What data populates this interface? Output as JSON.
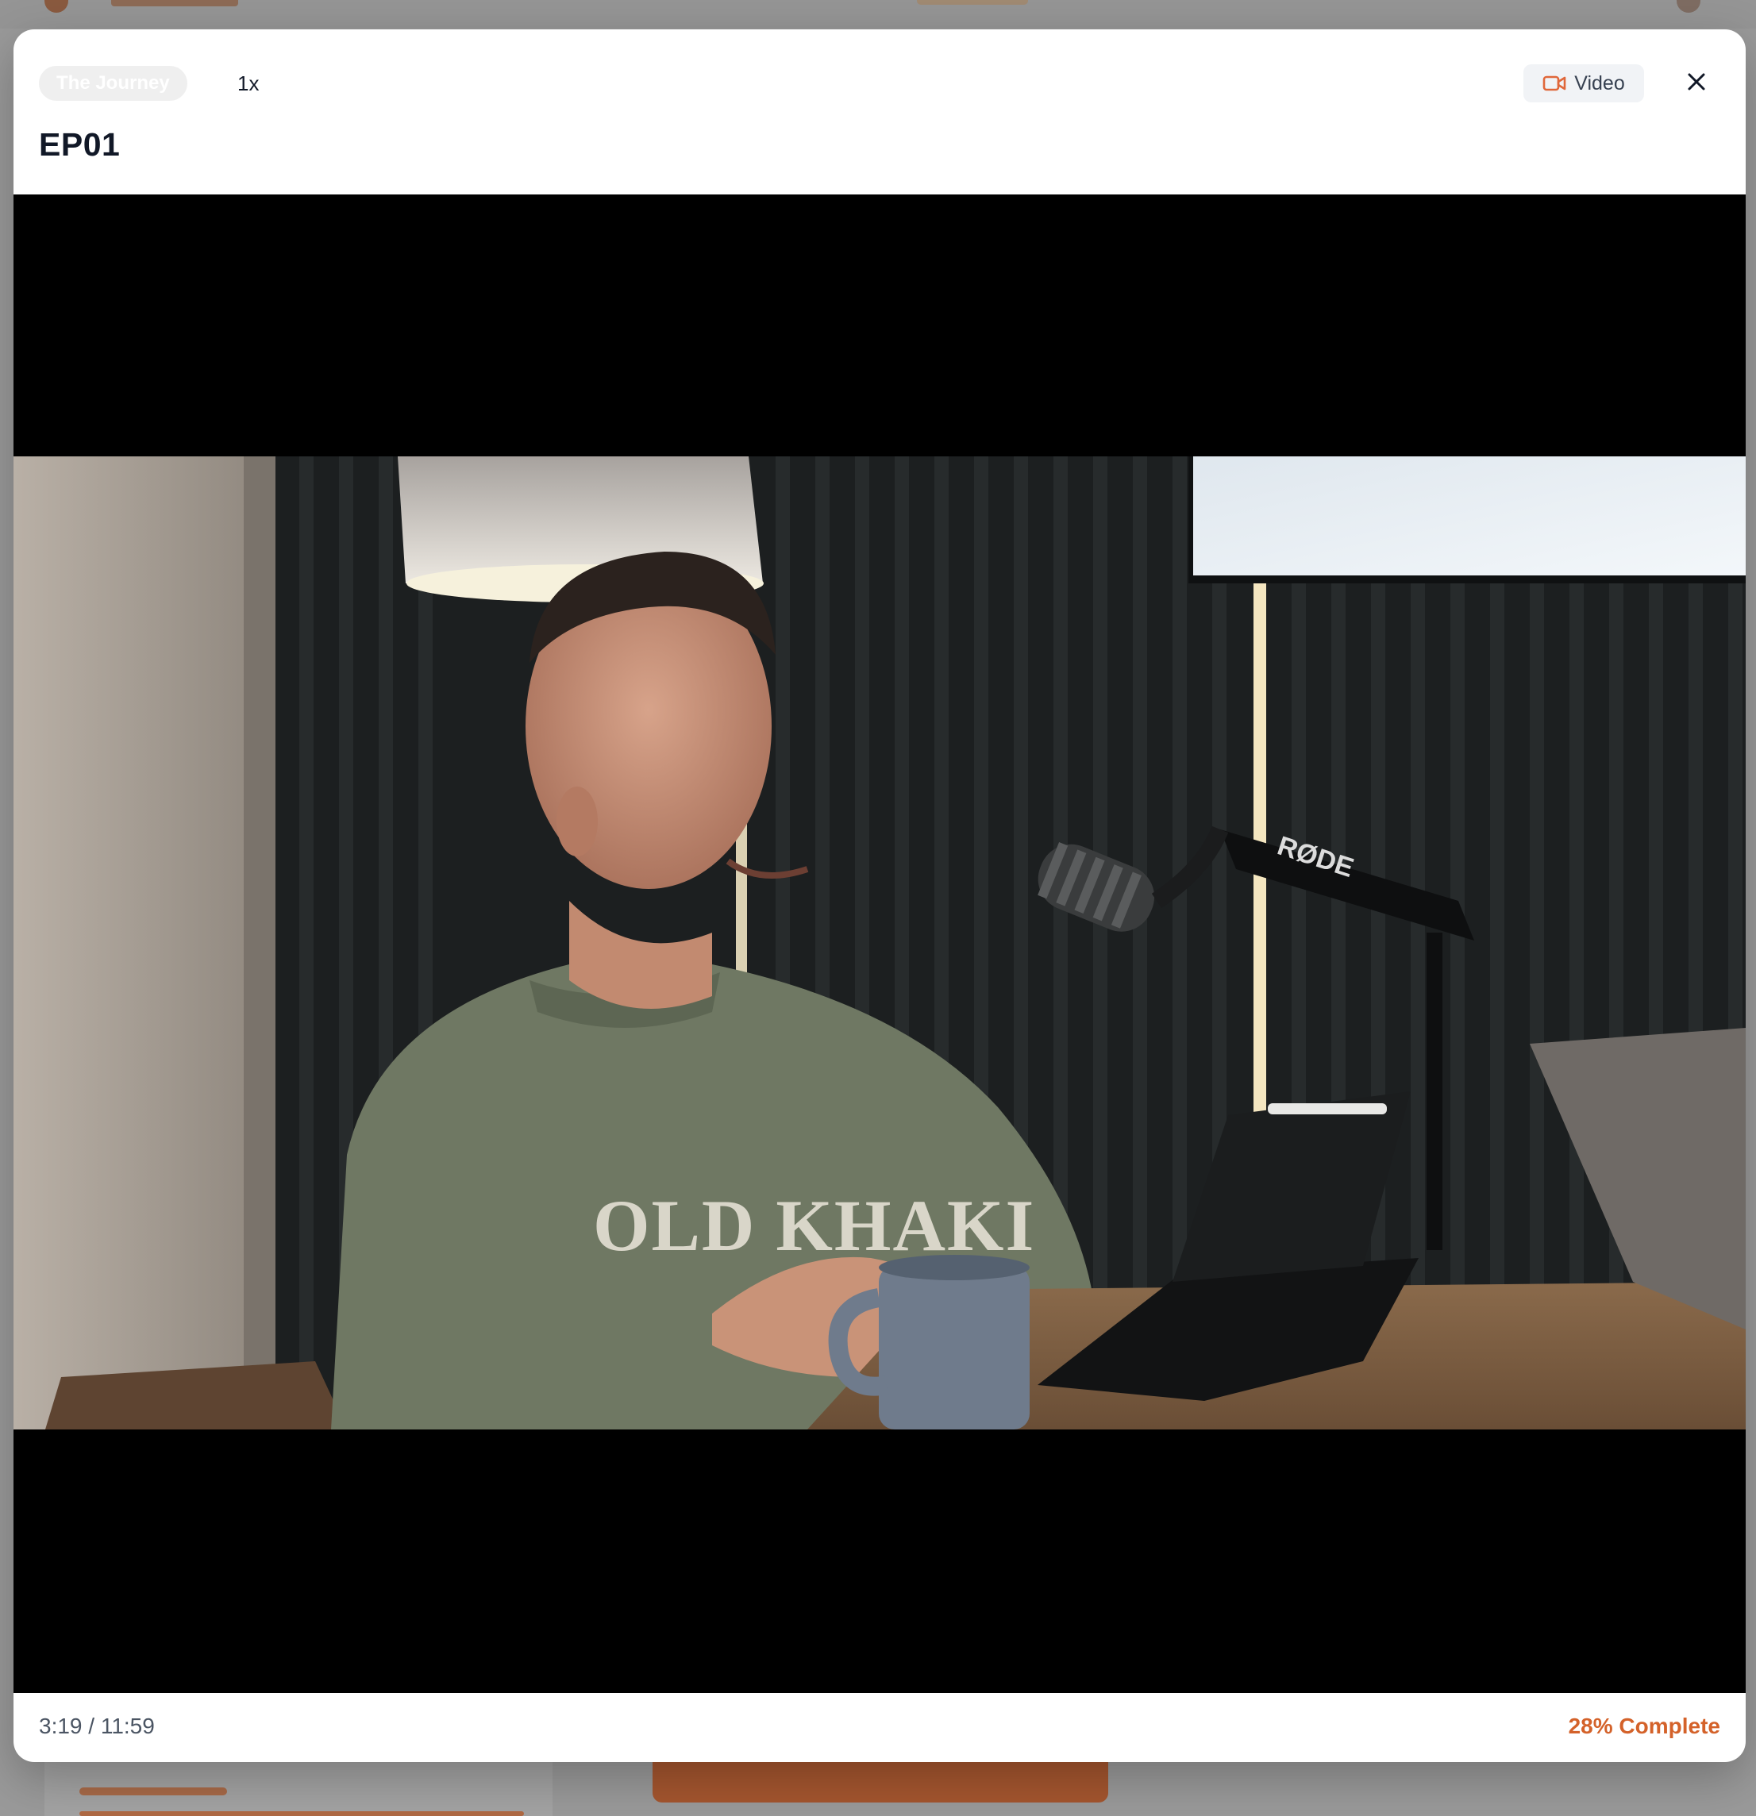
{
  "modal": {
    "series_label": "The Journey",
    "speed_label": "1x",
    "media_type_label": "Video",
    "episode_title": "EP01"
  },
  "player": {
    "current_time": "3:19",
    "duration": "11:59",
    "time_display": "3:19 / 11:59",
    "progress_text": "28% Complete",
    "progress_fraction": 0.28,
    "sweatshirt_text": "OLD KHAKI",
    "mic_brand": "RØDE"
  },
  "colors": {
    "accent": "#d4622a",
    "video_icon": "#e0673a",
    "title_text": "#111827",
    "muted_text": "#4b5563"
  },
  "icons": {
    "media_type": "video-camera-icon",
    "close": "close-icon"
  }
}
